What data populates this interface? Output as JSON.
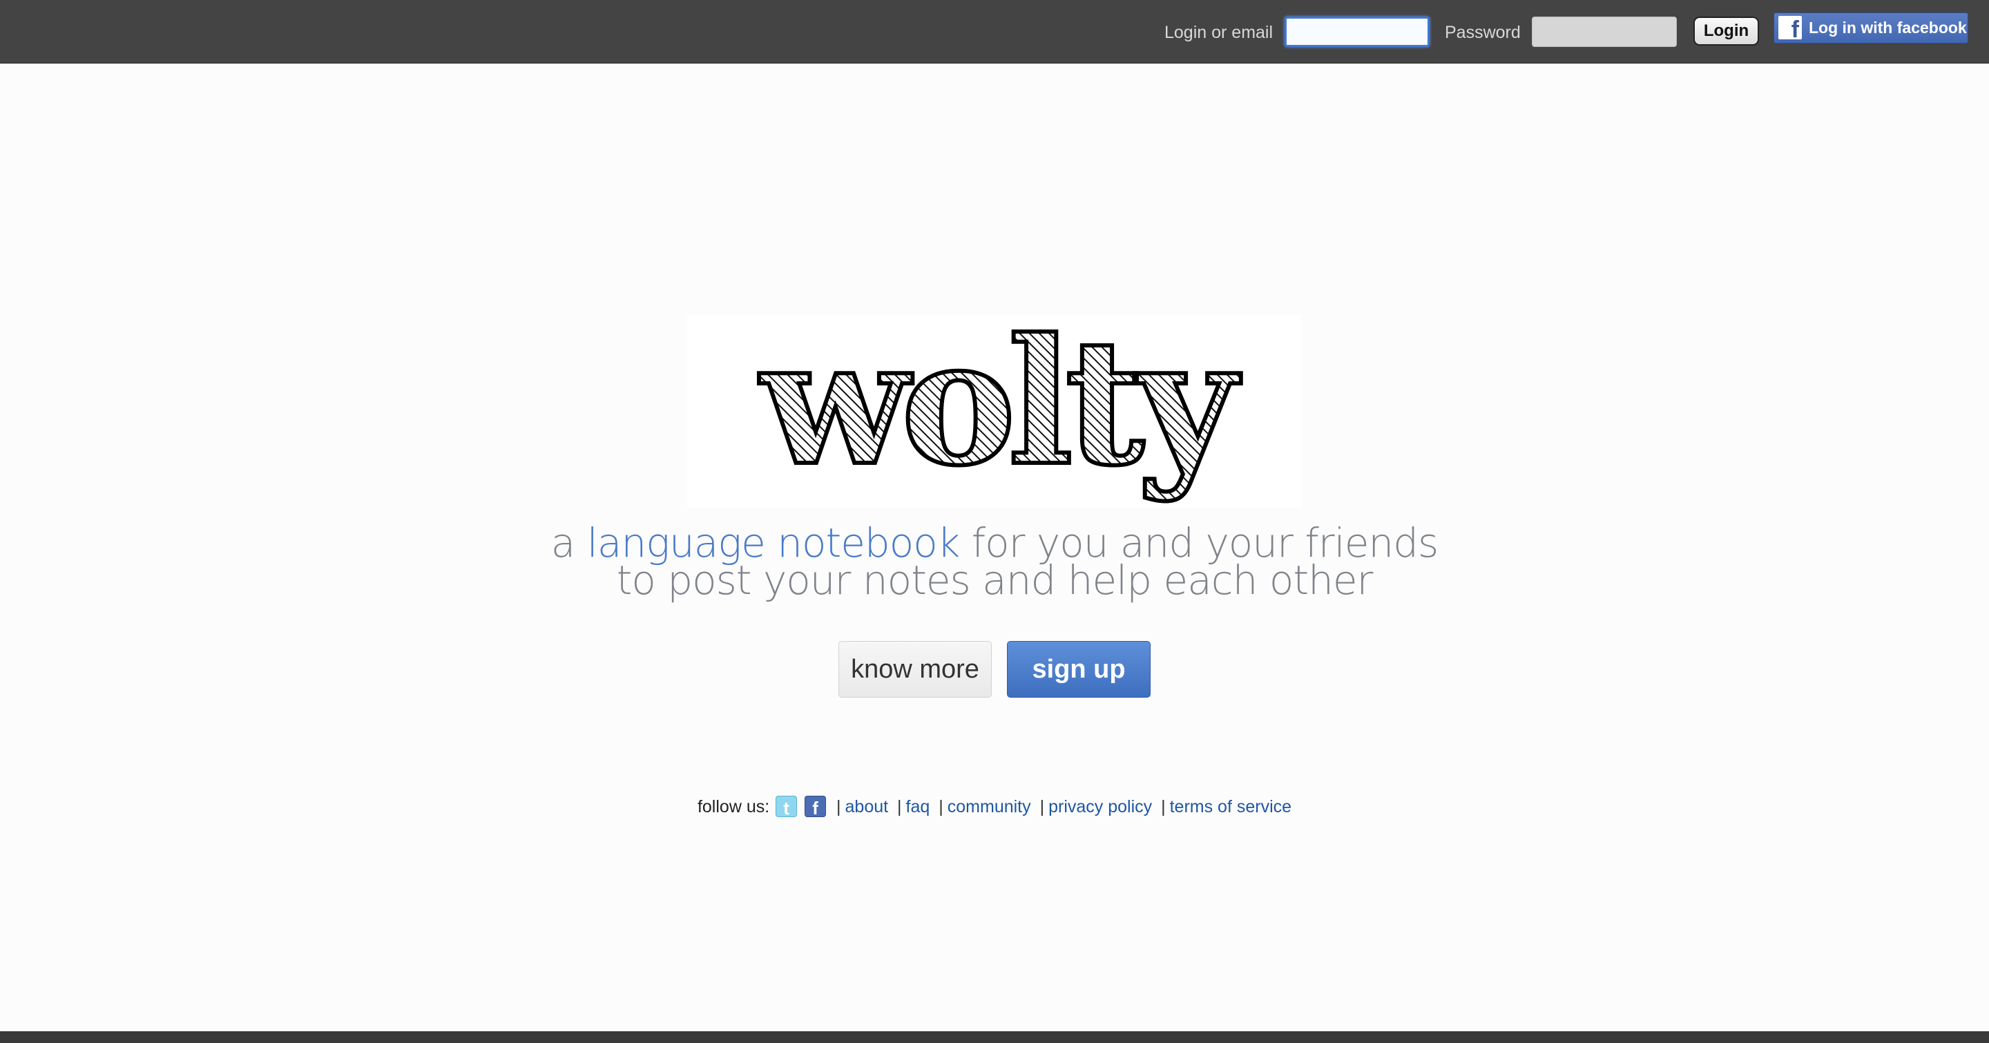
{
  "header": {
    "login_label": "Login or email",
    "password_label": "Password",
    "login_button": "Login",
    "facebook_button": "Log in with facebook"
  },
  "hero": {
    "logo_text": "wolty",
    "tagline": {
      "prefix": "a",
      "highlight": "language notebook",
      "suffix": "for you and your friends",
      "line2": "to post your notes and help each other"
    },
    "know_more": "know more",
    "sign_up": "sign up"
  },
  "footer": {
    "follow_us": "follow us:",
    "links": {
      "about": "about",
      "faq": "faq",
      "community": "community",
      "privacy": "privacy policy",
      "terms": "terms of service"
    },
    "separator": "|"
  },
  "colors": {
    "accent_blue": "#4a7bc7",
    "link_blue": "#1f56a3",
    "topbar": "#444444"
  }
}
